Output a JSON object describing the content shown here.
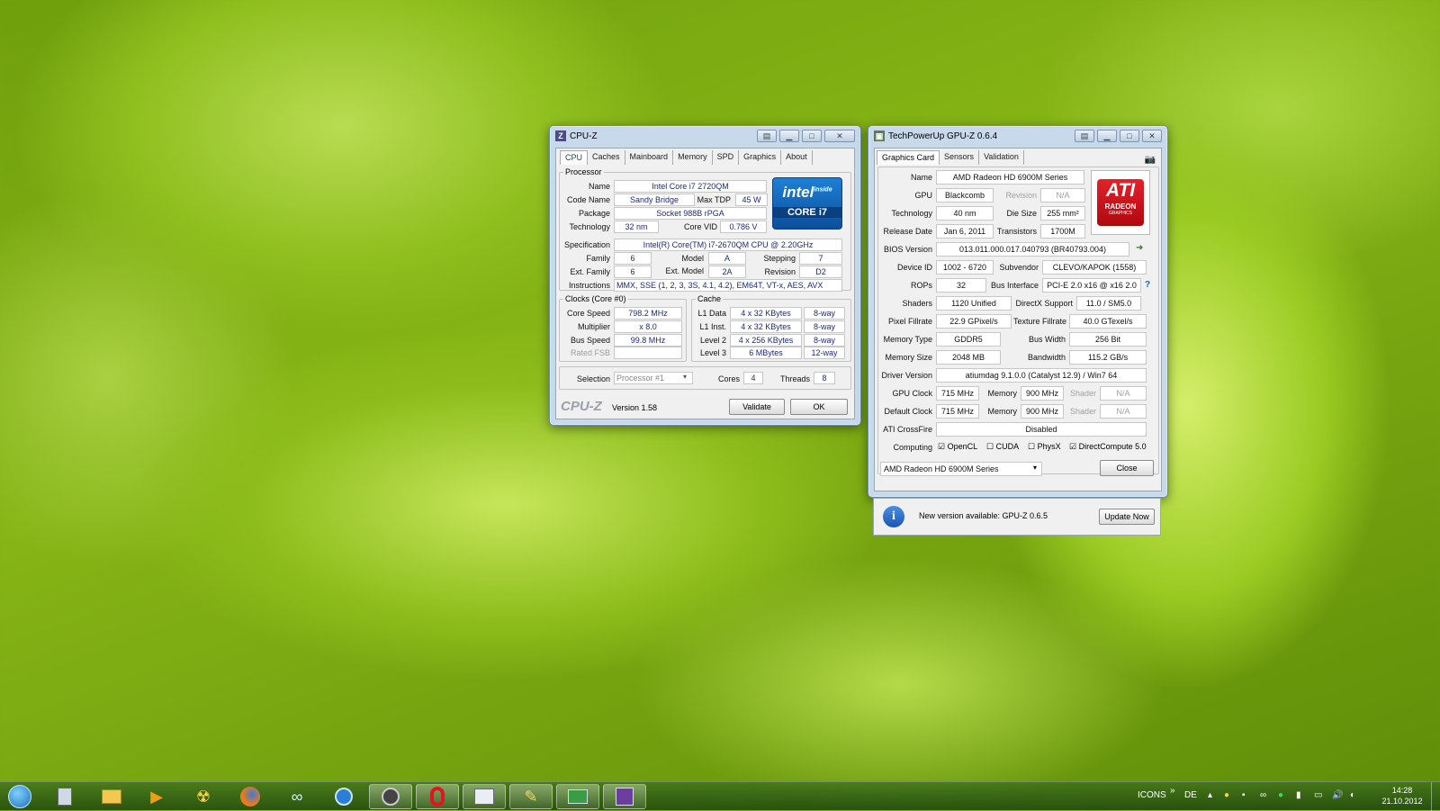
{
  "cpuz": {
    "title": "CPU-Z",
    "tabs": [
      "CPU",
      "Caches",
      "Mainboard",
      "Memory",
      "SPD",
      "Graphics",
      "About"
    ],
    "processor_label": "Processor",
    "name_label": "Name",
    "name": "Intel Core i7 2720QM",
    "codename_label": "Code Name",
    "codename": "Sandy Bridge",
    "maxtdp_label": "Max TDP",
    "maxtdp": "45 W",
    "package_label": "Package",
    "package": "Socket 988B rPGA",
    "technology_label": "Technology",
    "technology": "32 nm",
    "corevid_label": "Core VID",
    "corevid": "0.786 V",
    "spec_label": "Specification",
    "spec": "Intel(R) Core(TM) i7-2670QM CPU @ 2.20GHz",
    "family_label": "Family",
    "family": "6",
    "model_label": "Model",
    "model": "A",
    "stepping_label": "Stepping",
    "stepping": "7",
    "extfamily_label": "Ext. Family",
    "extfamily": "6",
    "extmodel_label": "Ext. Model",
    "extmodel": "2A",
    "revision_label": "Revision",
    "revision": "D2",
    "instructions_label": "Instructions",
    "instructions": "MMX, SSE (1, 2, 3, 3S, 4.1, 4.2), EM64T, VT-x, AES, AVX",
    "clocks_label": "Clocks (Core #0)",
    "corespeed_label": "Core Speed",
    "corespeed": "798.2 MHz",
    "multiplier_label": "Multiplier",
    "multiplier": "x 8.0",
    "busspeed_label": "Bus Speed",
    "busspeed": "99.8 MHz",
    "ratedfsb_label": "Rated FSB",
    "cache_label": "Cache",
    "l1d_label": "L1 Data",
    "l1d": "4 x 32 KBytes",
    "l1d_way": "8-way",
    "l1i_label": "L1 Inst.",
    "l1i": "4 x 32 KBytes",
    "l1i_way": "8-way",
    "l2_label": "Level 2",
    "l2": "4 x 256 KBytes",
    "l2_way": "8-way",
    "l3_label": "Level 3",
    "l3": "6 MBytes",
    "l3_way": "12-way",
    "selection_label": "Selection",
    "selection": "Processor #1",
    "cores_label": "Cores",
    "cores": "4",
    "threads_label": "Threads",
    "threads": "8",
    "brand": "CPU-Z",
    "version": "Version 1.58",
    "validate": "Validate",
    "ok": "OK",
    "logo_top": "intel",
    "logo_inside": "inside",
    "logo_bottom": "CORE i7"
  },
  "gpuz": {
    "title": "TechPowerUp GPU-Z 0.6.4",
    "tabs": [
      "Graphics Card",
      "Sensors",
      "Validation"
    ],
    "name_label": "Name",
    "name": "AMD Radeon HD 6900M Series",
    "gpu_label": "GPU",
    "gpu": "Blackcomb",
    "revision_label": "Revision",
    "revision": "N/A",
    "technology_label": "Technology",
    "technology": "40 nm",
    "diesize_label": "Die Size",
    "diesize": "255 mm²",
    "releasedate_label": "Release Date",
    "releasedate": "Jan 6, 2011",
    "transistors_label": "Transistors",
    "transistors": "1700M",
    "bios_label": "BIOS Version",
    "bios": "013.011.000.017.040793 (BR40793.004)",
    "deviceid_label": "Device ID",
    "deviceid": "1002 - 6720",
    "subvendor_label": "Subvendor",
    "subvendor": "CLEVO/KAPOK (1558)",
    "rops_label": "ROPs",
    "rops": "32",
    "businterface_label": "Bus Interface",
    "businterface": "PCI-E 2.0 x16 @ x16 2.0",
    "help": "?",
    "shaders_label": "Shaders",
    "shaders": "1120 Unified",
    "directx_label": "DirectX Support",
    "directx": "11.0 / SM5.0",
    "pixelfill_label": "Pixel Fillrate",
    "pixelfill": "22.9 GPixel/s",
    "texturefill_label": "Texture Fillrate",
    "texturefill": "40.0 GTexel/s",
    "memtype_label": "Memory Type",
    "memtype": "GDDR5",
    "buswidth_label": "Bus Width",
    "buswidth": "256 Bit",
    "memsize_label": "Memory Size",
    "memsize": "2048 MB",
    "bandwidth_label": "Bandwidth",
    "bandwidth": "115.2 GB/s",
    "driver_label": "Driver Version",
    "driver": "atiumdag 9.1.0.0 (Catalyst 12.9) / Win7 64",
    "gpuclock_label": "GPU Clock",
    "gpuclock": "715 MHz",
    "memory_label": "Memory",
    "memclock": "900 MHz",
    "shader_label": "Shader",
    "shaderclock": "N/A",
    "defclock_label": "Default Clock",
    "defclock": "715 MHz",
    "defmem": "900 MHz",
    "defshader": "N/A",
    "crossfire_label": "ATI CrossFire",
    "crossfire": "Disabled",
    "computing_label": "Computing",
    "opencl": "OpenCL",
    "cuda": "CUDA",
    "physx": "PhysX",
    "directcompute": "DirectCompute 5.0",
    "selected_card": "AMD Radeon HD 6900M Series",
    "close": "Close",
    "update_msg": "New version available: GPU-Z 0.6.5",
    "update_btn": "Update Now",
    "logo_top": "ATI",
    "logo_bottom": "RADEON",
    "logo_sub": "GRAPHICS"
  },
  "taskbar": {
    "icons_label": "ICONS",
    "lang": "DE",
    "time": "14:28",
    "date": "21.10.2012"
  },
  "colors": {
    "intel_blue": "#0b6fc6",
    "ati_red": "#d4131b"
  }
}
